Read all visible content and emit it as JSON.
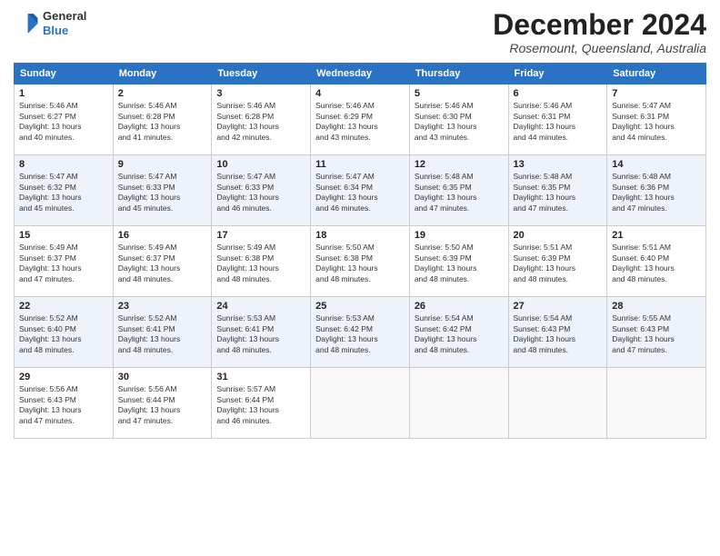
{
  "logo": {
    "line1": "General",
    "line2": "Blue"
  },
  "header": {
    "title": "December 2024",
    "subtitle": "Rosemount, Queensland, Australia"
  },
  "weekdays": [
    "Sunday",
    "Monday",
    "Tuesday",
    "Wednesday",
    "Thursday",
    "Friday",
    "Saturday"
  ],
  "weeks": [
    [
      {
        "day": 1,
        "sunrise": "5:46 AM",
        "sunset": "6:27 PM",
        "daylight": "13 hours and 40 minutes."
      },
      {
        "day": 2,
        "sunrise": "5:46 AM",
        "sunset": "6:28 PM",
        "daylight": "13 hours and 41 minutes."
      },
      {
        "day": 3,
        "sunrise": "5:46 AM",
        "sunset": "6:28 PM",
        "daylight": "13 hours and 42 minutes."
      },
      {
        "day": 4,
        "sunrise": "5:46 AM",
        "sunset": "6:29 PM",
        "daylight": "13 hours and 43 minutes."
      },
      {
        "day": 5,
        "sunrise": "5:46 AM",
        "sunset": "6:30 PM",
        "daylight": "13 hours and 43 minutes."
      },
      {
        "day": 6,
        "sunrise": "5:46 AM",
        "sunset": "6:31 PM",
        "daylight": "13 hours and 44 minutes."
      },
      {
        "day": 7,
        "sunrise": "5:47 AM",
        "sunset": "6:31 PM",
        "daylight": "13 hours and 44 minutes."
      }
    ],
    [
      {
        "day": 8,
        "sunrise": "5:47 AM",
        "sunset": "6:32 PM",
        "daylight": "13 hours and 45 minutes."
      },
      {
        "day": 9,
        "sunrise": "5:47 AM",
        "sunset": "6:33 PM",
        "daylight": "13 hours and 45 minutes."
      },
      {
        "day": 10,
        "sunrise": "5:47 AM",
        "sunset": "6:33 PM",
        "daylight": "13 hours and 46 minutes."
      },
      {
        "day": 11,
        "sunrise": "5:47 AM",
        "sunset": "6:34 PM",
        "daylight": "13 hours and 46 minutes."
      },
      {
        "day": 12,
        "sunrise": "5:48 AM",
        "sunset": "6:35 PM",
        "daylight": "13 hours and 47 minutes."
      },
      {
        "day": 13,
        "sunrise": "5:48 AM",
        "sunset": "6:35 PM",
        "daylight": "13 hours and 47 minutes."
      },
      {
        "day": 14,
        "sunrise": "5:48 AM",
        "sunset": "6:36 PM",
        "daylight": "13 hours and 47 minutes."
      }
    ],
    [
      {
        "day": 15,
        "sunrise": "5:49 AM",
        "sunset": "6:37 PM",
        "daylight": "13 hours and 47 minutes."
      },
      {
        "day": 16,
        "sunrise": "5:49 AM",
        "sunset": "6:37 PM",
        "daylight": "13 hours and 48 minutes."
      },
      {
        "day": 17,
        "sunrise": "5:49 AM",
        "sunset": "6:38 PM",
        "daylight": "13 hours and 48 minutes."
      },
      {
        "day": 18,
        "sunrise": "5:50 AM",
        "sunset": "6:38 PM",
        "daylight": "13 hours and 48 minutes."
      },
      {
        "day": 19,
        "sunrise": "5:50 AM",
        "sunset": "6:39 PM",
        "daylight": "13 hours and 48 minutes."
      },
      {
        "day": 20,
        "sunrise": "5:51 AM",
        "sunset": "6:39 PM",
        "daylight": "13 hours and 48 minutes."
      },
      {
        "day": 21,
        "sunrise": "5:51 AM",
        "sunset": "6:40 PM",
        "daylight": "13 hours and 48 minutes."
      }
    ],
    [
      {
        "day": 22,
        "sunrise": "5:52 AM",
        "sunset": "6:40 PM",
        "daylight": "13 hours and 48 minutes."
      },
      {
        "day": 23,
        "sunrise": "5:52 AM",
        "sunset": "6:41 PM",
        "daylight": "13 hours and 48 minutes."
      },
      {
        "day": 24,
        "sunrise": "5:53 AM",
        "sunset": "6:41 PM",
        "daylight": "13 hours and 48 minutes."
      },
      {
        "day": 25,
        "sunrise": "5:53 AM",
        "sunset": "6:42 PM",
        "daylight": "13 hours and 48 minutes."
      },
      {
        "day": 26,
        "sunrise": "5:54 AM",
        "sunset": "6:42 PM",
        "daylight": "13 hours and 48 minutes."
      },
      {
        "day": 27,
        "sunrise": "5:54 AM",
        "sunset": "6:43 PM",
        "daylight": "13 hours and 48 minutes."
      },
      {
        "day": 28,
        "sunrise": "5:55 AM",
        "sunset": "6:43 PM",
        "daylight": "13 hours and 47 minutes."
      }
    ],
    [
      {
        "day": 29,
        "sunrise": "5:56 AM",
        "sunset": "6:43 PM",
        "daylight": "13 hours and 47 minutes."
      },
      {
        "day": 30,
        "sunrise": "5:56 AM",
        "sunset": "6:44 PM",
        "daylight": "13 hours and 47 minutes."
      },
      {
        "day": 31,
        "sunrise": "5:57 AM",
        "sunset": "6:44 PM",
        "daylight": "13 hours and 46 minutes."
      },
      null,
      null,
      null,
      null
    ]
  ],
  "labels": {
    "sunrise": "Sunrise:",
    "sunset": "Sunset:",
    "daylight": "Daylight:"
  },
  "colors": {
    "header_bg": "#2a72c3",
    "alt_row": "#eef2fa"
  }
}
